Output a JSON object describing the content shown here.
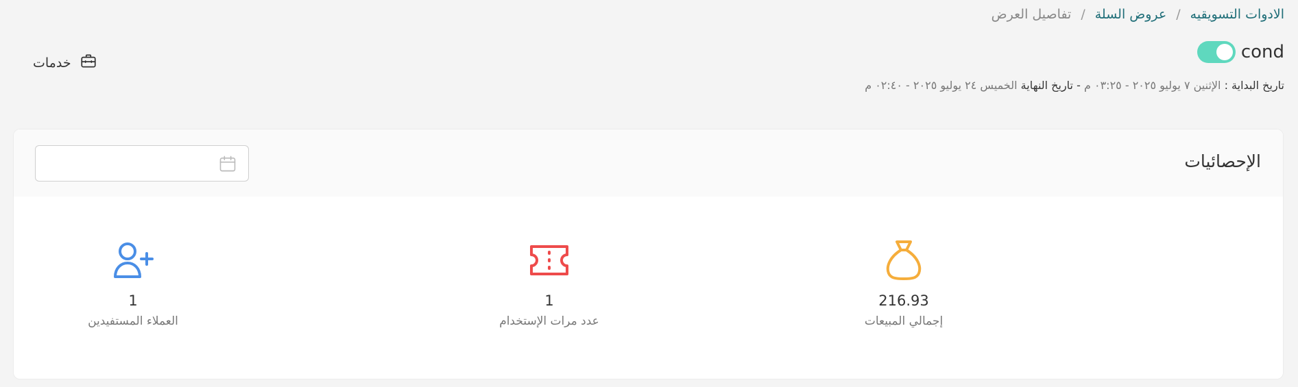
{
  "breadcrumb": {
    "items": [
      "الادوات التسويقيه",
      "عروض السلة",
      "تفاصيل العرض"
    ],
    "separator": "/"
  },
  "offer": {
    "name": "cond",
    "enabled": true,
    "toggle_color": "#5fd8be"
  },
  "dates": {
    "start_label": "تاريخ البداية :",
    "start_value": "الإثنين ٧ يوليو ٢٠٢٥ - ٠٣:٢٥ م",
    "dash": "-",
    "end_label": "تاريخ النهاية",
    "end_value": "الخميس ٢٤ يوليو ٢٠٢٥ - ٠٢:٤٠ م"
  },
  "services": {
    "label": "خدمات",
    "icon": "briefcase-icon"
  },
  "stats_card": {
    "title": "الإحصائيات",
    "date_picker": {
      "placeholder": "",
      "icon": "calendar-icon"
    },
    "items": [
      {
        "icon": "money-bag-icon",
        "value": "216.93",
        "label": "إجمالي المبيعات",
        "color": "#f5ad3b"
      },
      {
        "icon": "ticket-icon",
        "value": "1",
        "label": "عدد مرات الإستخدام",
        "color": "#ee4b4b"
      },
      {
        "icon": "user-plus-icon",
        "value": "1",
        "label": "العملاء المستفيدين",
        "color": "#4a8ee6"
      }
    ]
  }
}
